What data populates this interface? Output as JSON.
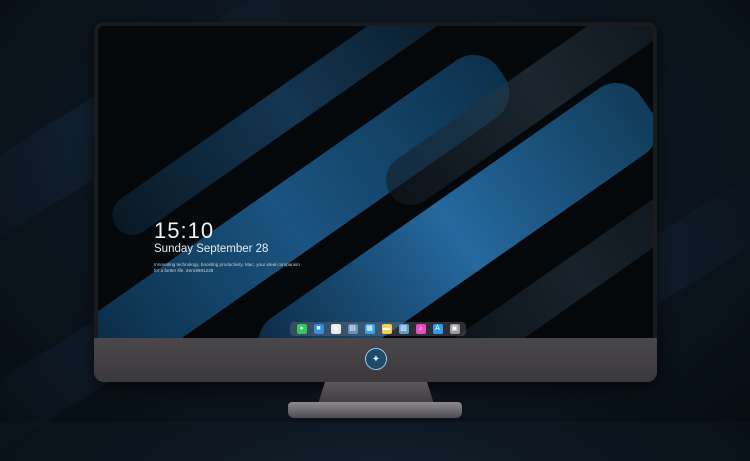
{
  "lockscreen": {
    "time": "15:10",
    "date": "Sunday September 28",
    "tagline": "Innovating technology, boosting productivity. Mac, your ideal companion for a better life. Zero9981238"
  },
  "dock": {
    "icons": [
      {
        "name": "messages-icon",
        "glyph": "●",
        "color": "#34c759"
      },
      {
        "name": "finder-icon",
        "glyph": "■",
        "color": "#2f8de4"
      },
      {
        "name": "safari-icon",
        "glyph": "◉",
        "color": "#e8e8e8"
      },
      {
        "name": "preview-icon",
        "glyph": "▤",
        "color": "#6b8fb8"
      },
      {
        "name": "clapper-icon",
        "glyph": "▦",
        "color": "#3aa3e0"
      },
      {
        "name": "notes-icon",
        "glyph": "▬",
        "color": "#f5d04a"
      },
      {
        "name": "photos-icon",
        "glyph": "▧",
        "color": "#5aa0d8"
      },
      {
        "name": "music-icon",
        "glyph": "♪",
        "color": "#e94cc7"
      },
      {
        "name": "app-store-icon",
        "glyph": "A",
        "color": "#2f9df0"
      },
      {
        "name": "system-icon",
        "glyph": "▣",
        "color": "#9a9aa0"
      }
    ]
  },
  "colors": {
    "accent": "#1f6fb0",
    "bezel": "#1a1b1f",
    "chin": "#3f3c40"
  }
}
